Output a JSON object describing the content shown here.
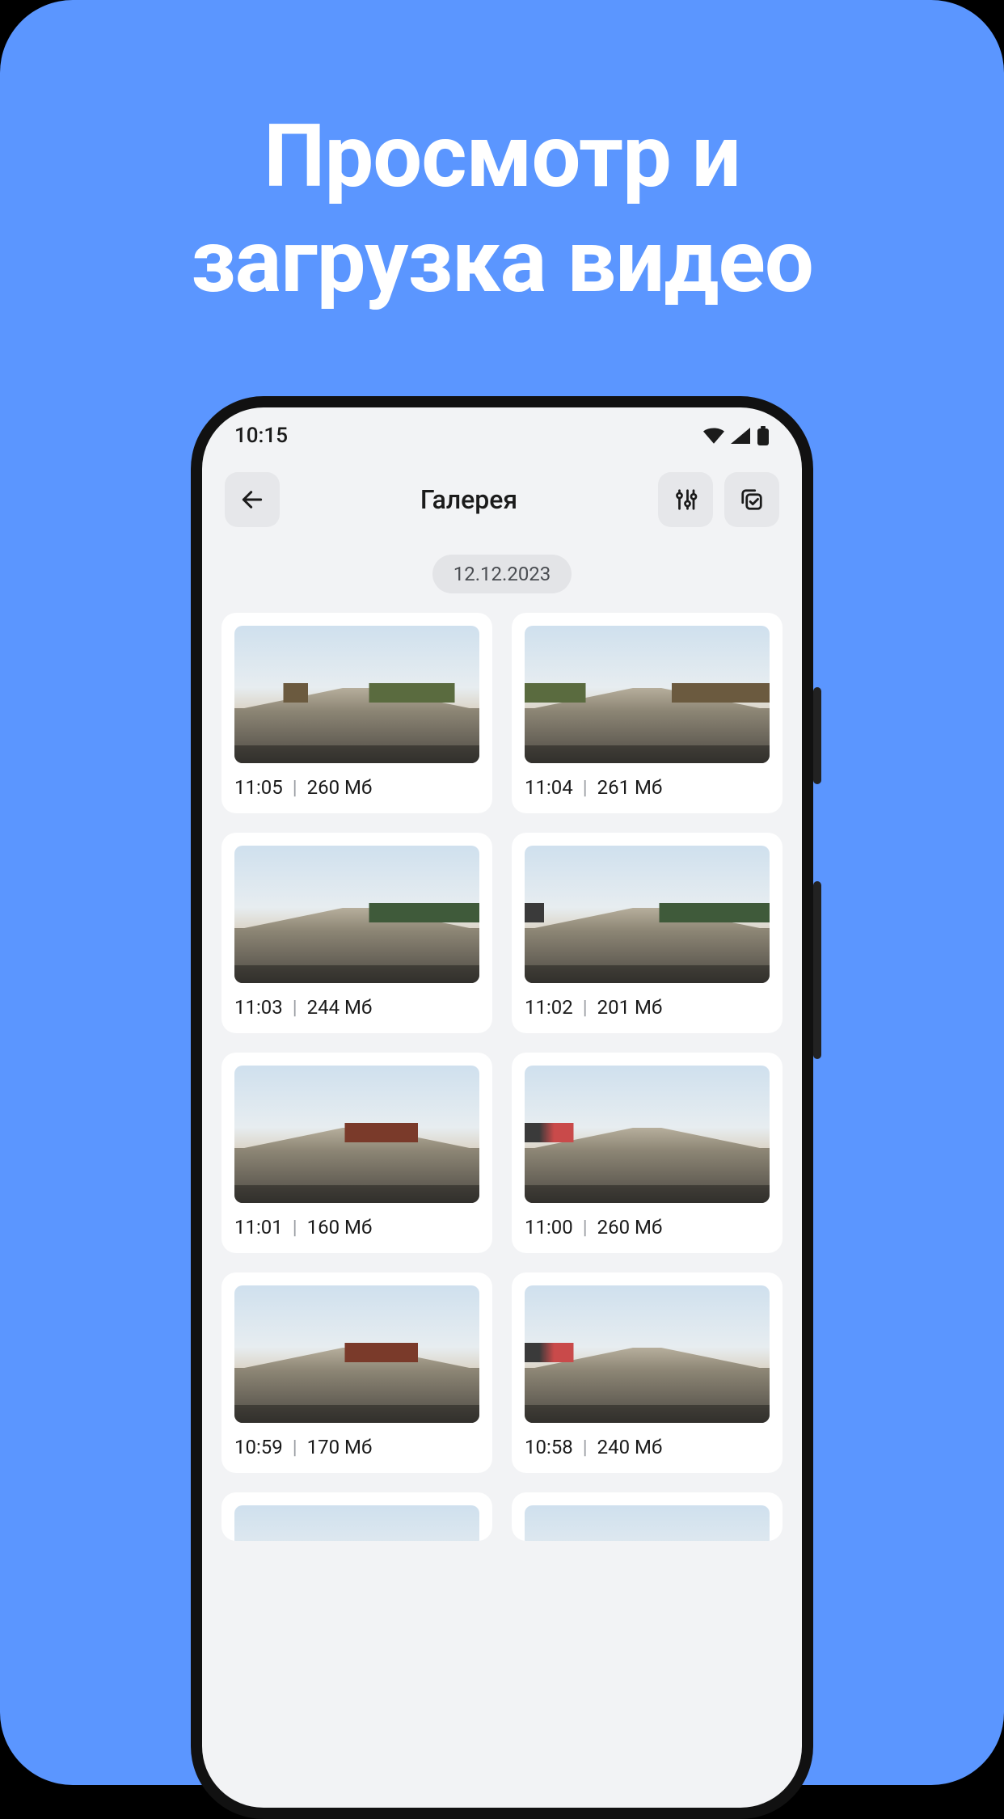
{
  "promo": {
    "headline_line1": "Просмотр и",
    "headline_line2": "загрузка видео"
  },
  "statusbar": {
    "time": "10:15"
  },
  "appbar": {
    "title": "Галерея"
  },
  "date_label": "12.12.2023",
  "separator": "|",
  "items": [
    {
      "time": "11:05",
      "size": "260 Мб"
    },
    {
      "time": "11:04",
      "size": "261 Мб"
    },
    {
      "time": "11:03",
      "size": "244 Мб"
    },
    {
      "time": "11:02",
      "size": "201 Мб"
    },
    {
      "time": "11:01",
      "size": "160 Мб"
    },
    {
      "time": "11:00",
      "size": "260 Мб"
    },
    {
      "time": "10:59",
      "size": "170 Мб"
    },
    {
      "time": "10:58",
      "size": "240 Мб"
    }
  ]
}
